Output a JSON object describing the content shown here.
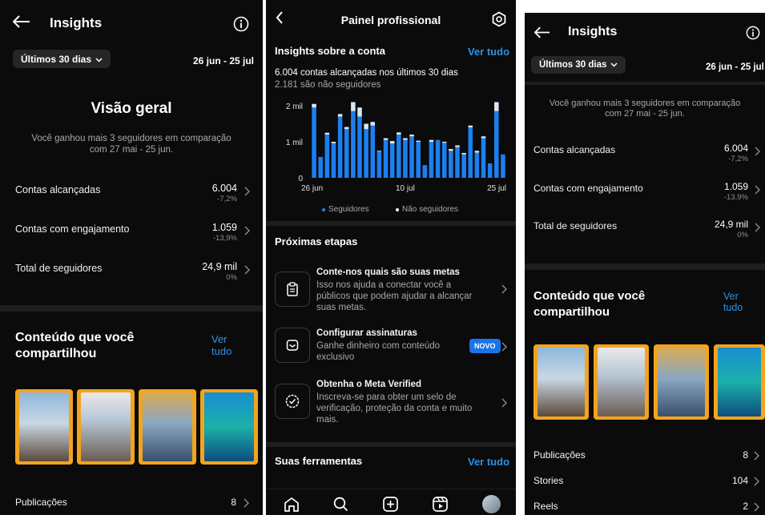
{
  "colors": {
    "accent": "#2e90e8",
    "bar_followers": "#1c7ff0",
    "bar_non_followers": "#dbe6f2",
    "thumb_border": "#f2a41e"
  },
  "panel1": {
    "title": "Insights",
    "back_icon": "back-arrow-icon",
    "info_icon": "info-icon",
    "filter_label": "Últimos 30 dias",
    "date_range": "26 jun - 25 jul",
    "overview_title": "Visão geral",
    "overview_sub_1": "Você ganhou mais 3 seguidores em comparação",
    "overview_sub_2": "com 27 mai - 25 jun.",
    "metrics": [
      {
        "label": "Contas alcançadas",
        "value": "6.004",
        "change": "-7,2%"
      },
      {
        "label": "Contas com engajamento",
        "value": "1.059",
        "change": "-13,9%"
      },
      {
        "label": "Total de seguidores",
        "value": "24,9 mil",
        "change": "0%"
      }
    ],
    "content_title_1": "Conteúdo que você",
    "content_title_2": "compartilhou",
    "see_all_1": "Ver",
    "see_all_2": "tudo",
    "rows": [
      {
        "label": "Publicações",
        "value": "8"
      }
    ]
  },
  "panel2": {
    "title": "Painel profissional",
    "back_icon": "chevron-left-icon",
    "settings_icon": "settings-icon",
    "insights_title": "Insights sobre a conta",
    "see_all": "Ver tudo",
    "reach_summary": "6.004 contas alcançadas nos últimos 30 dias",
    "non_followers_summary": "2.181 são não seguidores",
    "legend_followers": "Seguidores",
    "legend_non_followers": "Não seguidores",
    "next_steps_title": "Próximas etapas",
    "steps": [
      {
        "icon": "clipboard-icon",
        "title": "Conte-nos quais são suas metas",
        "desc": "Isso nos ajuda a conectar você a públicos que podem ajudar a alcançar suas metas."
      },
      {
        "icon": "subscription-icon",
        "title": "Configurar assinaturas",
        "desc": "Ganhe dinheiro com conteúdo exclusivo",
        "badge": "NOVO"
      },
      {
        "icon": "verified-badge-icon",
        "title": "Obtenha o Meta Verified",
        "desc": "Inscreva-se para obter um selo de verificação, proteção da conta e muito mais."
      }
    ],
    "tools_title": "Suas ferramentas",
    "tools_see_all": "Ver tudo",
    "nav": [
      "home-icon",
      "search-icon",
      "create-icon",
      "reels-icon",
      "profile-avatar-icon"
    ]
  },
  "chart_data": {
    "type": "bar",
    "stacked": true,
    "x": [
      "26 jun",
      "27 jun",
      "28 jun",
      "29 jun",
      "30 jun",
      "1 jul",
      "2 jul",
      "3 jul",
      "4 jul",
      "5 jul",
      "6 jul",
      "7 jul",
      "8 jul",
      "9 jul",
      "10 jul",
      "11 jul",
      "12 jul",
      "13 jul",
      "14 jul",
      "15 jul",
      "16 jul",
      "17 jul",
      "18 jul",
      "19 jul",
      "20 jul",
      "21 jul",
      "22 jul",
      "23 jul",
      "24 jul",
      "25 jul"
    ],
    "x_tick_labels": [
      "26 jun",
      "10 jul",
      "25 jul"
    ],
    "y_tick_labels": [
      "2 mil",
      "1 mil",
      "0"
    ],
    "ylim": [
      0,
      2000
    ],
    "series": [
      {
        "name": "Seguidores",
        "values": [
          1950,
          580,
          1200,
          960,
          1700,
          1350,
          1850,
          1700,
          1350,
          1450,
          730,
          1050,
          950,
          1200,
          1050,
          1150,
          1000,
          350,
          1000,
          1050,
          970,
          750,
          850,
          650,
          1400,
          700,
          1100,
          400,
          1850,
          650
        ]
      },
      {
        "name": "Não seguidores",
        "values": [
          100,
          0,
          50,
          40,
          70,
          60,
          250,
          250,
          150,
          100,
          20,
          50,
          70,
          60,
          50,
          50,
          30,
          0,
          50,
          0,
          30,
          50,
          50,
          40,
          50,
          50,
          50,
          0,
          250,
          0
        ]
      }
    ]
  },
  "panel3": {
    "title": "Insights",
    "back_icon": "back-arrow-icon",
    "info_icon": "info-icon",
    "filter_label": "Últimos 30 dias",
    "date_range": "26 jun - 25 jul",
    "sub_1": "Você ganhou mais 3 seguidores em comparação",
    "sub_2": "com 27 mai - 25 jun.",
    "metrics": [
      {
        "label": "Contas alcançadas",
        "value": "6.004",
        "change": "-7,2%"
      },
      {
        "label": "Contas com engajamento",
        "value": "1.059",
        "change": "-13,9%"
      },
      {
        "label": "Total de seguidores",
        "value": "24,9 mil",
        "change": "0%"
      }
    ],
    "content_title_1": "Conteúdo que você",
    "content_title_2": "compartilhou",
    "see_all_1": "Ver",
    "see_all_2": "tudo",
    "rows": [
      {
        "label": "Publicações",
        "value": "8"
      },
      {
        "label": "Stories",
        "value": "104"
      },
      {
        "label": "Reels",
        "value": "2"
      }
    ]
  }
}
